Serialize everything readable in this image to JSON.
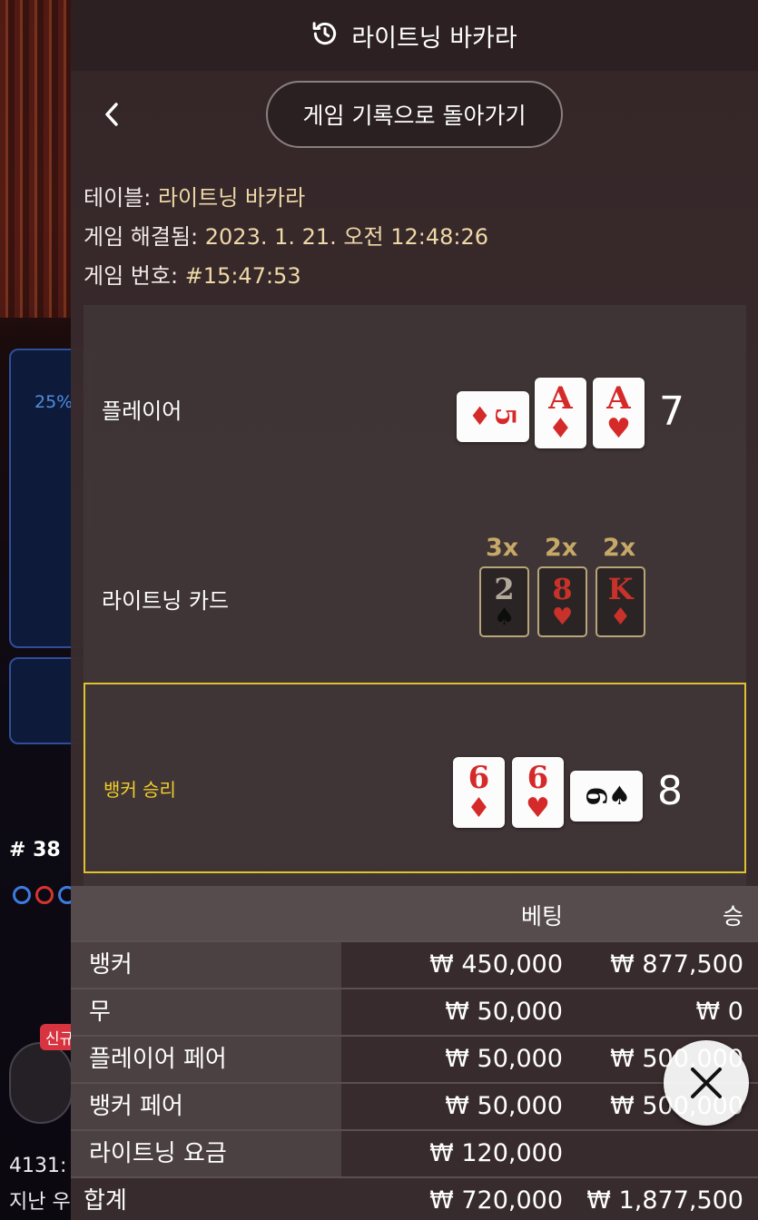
{
  "header": {
    "title": "라이트닝 바카라",
    "icon": "history-icon"
  },
  "nav": {
    "back_label": "게임 기록으로 돌아가기"
  },
  "info": {
    "table_label": "테이블:",
    "table_value": "라이트닝 바카라",
    "resolved_label": "게임 해결됨:",
    "resolved_value": "2023. 1. 21. 오전 12:48:26",
    "game_no_label": "게임 번호:",
    "game_no_value": "#15:47:53"
  },
  "player": {
    "label": "플레이어",
    "cards": [
      {
        "rank": "5",
        "suit": "♦",
        "color": "red",
        "orientation": "sideways"
      },
      {
        "rank": "A",
        "suit": "♦",
        "color": "red"
      },
      {
        "rank": "A",
        "suit": "♥",
        "color": "red"
      }
    ],
    "score": "7"
  },
  "lightning": {
    "label": "라이트닝 카드",
    "cards": [
      {
        "mult": "3x",
        "rank": "2",
        "suit": "♠"
      },
      {
        "mult": "2x",
        "rank": "8",
        "suit": "♥"
      },
      {
        "mult": "2x",
        "rank": "K",
        "suit": "♦"
      }
    ]
  },
  "banker": {
    "label": "뱅커 승리",
    "cards": [
      {
        "rank": "6",
        "suit": "♦",
        "color": "red"
      },
      {
        "rank": "6",
        "suit": "♥",
        "color": "red"
      },
      {
        "rank": "6",
        "suit": "♠",
        "color": "black",
        "orientation": "sideways"
      }
    ],
    "score": "8"
  },
  "bets": {
    "col_bet": "베팅",
    "col_win": "승",
    "rows": [
      {
        "name": "뱅커",
        "bet": "₩ 450,000",
        "win": "₩ 877,500"
      },
      {
        "name": "무",
        "bet": "₩ 50,000",
        "win": "₩ 0"
      },
      {
        "name": "플레이어 페어",
        "bet": "₩ 50,000",
        "win": "₩ 500,000"
      },
      {
        "name": "뱅커 페어",
        "bet": "₩ 50,000",
        "win": "₩ 500,000"
      },
      {
        "name": "라이트닝 요금",
        "bet": "₩ 120,000",
        "win": ""
      }
    ],
    "total": {
      "name": "합계",
      "bet": "₩ 720,000",
      "win": "₩ 1,877,500"
    }
  },
  "background": {
    "percent": "25%",
    "round": "# 38",
    "new_badge": "신규",
    "number": "4131:",
    "last": "지난 우"
  },
  "colors": {
    "accent_gold": "#e1c22e",
    "value_text": "#efd9a8",
    "card_red": "#d52a2a"
  }
}
